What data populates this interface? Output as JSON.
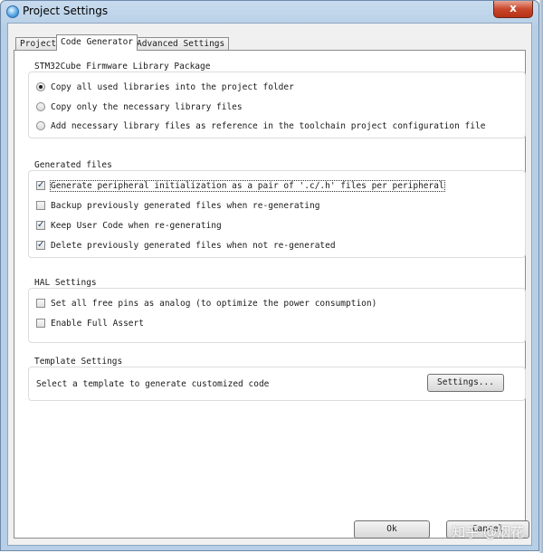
{
  "window": {
    "title": "Project Settings",
    "close_label": "x"
  },
  "tabs": [
    {
      "label": "Project"
    },
    {
      "label": "Code Generator"
    },
    {
      "label": "Advanced Settings"
    }
  ],
  "firmware": {
    "title": "STM32Cube Firmware Library Package",
    "options": [
      {
        "label": "Copy all used libraries into the project folder",
        "selected": true
      },
      {
        "label": "Copy only the necessary library files",
        "selected": false
      },
      {
        "label": "Add necessary library files as reference in the toolchain project configuration file",
        "selected": false
      }
    ]
  },
  "generated": {
    "title": "Generated files",
    "options": [
      {
        "label": "Generate peripheral initialization as a pair of '.c/.h' files per peripheral",
        "checked": true
      },
      {
        "label": "Backup previously generated files when re-generating",
        "checked": false
      },
      {
        "label": "Keep User Code when re-generating",
        "checked": true
      },
      {
        "label": "Delete previously generated files when not re-generated",
        "checked": true
      }
    ]
  },
  "hal": {
    "title": "HAL Settings",
    "options": [
      {
        "label": "Set all free pins as analog (to optimize the power consumption)",
        "checked": false
      },
      {
        "label": "Enable Full Assert",
        "checked": false
      }
    ]
  },
  "template": {
    "title": "Template Settings",
    "description": "Select a template to generate customized code",
    "button_label": "Settings..."
  },
  "footer": {
    "ok_label": "Ok",
    "cancel_label": "Cancel"
  },
  "watermark": "知乎 @烟花"
}
